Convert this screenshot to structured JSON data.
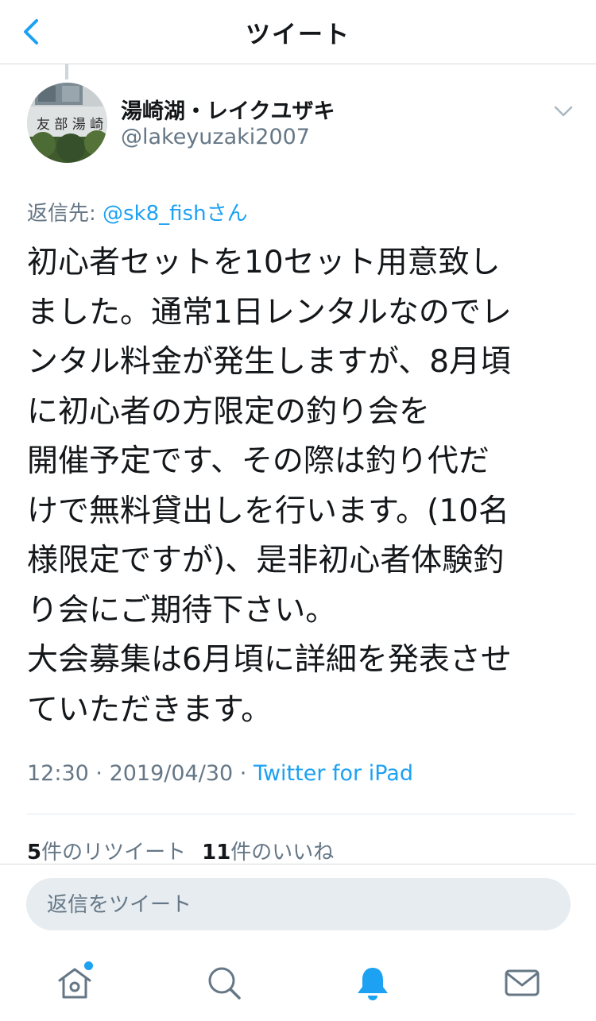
{
  "header": {
    "title": "ツイート"
  },
  "tweet": {
    "display_name": "湯崎湖・レイクユザキ",
    "handle": "@lakeyuzaki2007",
    "reply_to_prefix": "返信先: ",
    "reply_to_mention": "@sk8_fish",
    "reply_to_suffix": "さん",
    "body": "初心者セットを10セット用意致し\nました。通常1日レンタルなのでレ\nンタル料金が発生しますが、8月頃\nに初心者の方限定の釣り会を\n開催予定です、その際は釣り代だ\nけで無料貸出しを行います。(10名\n様限定ですが)、是非初心者体験釣\nり会にご期待下さい。\n大会募集は6月頃に詳細を発表させ\nていただきます。",
    "time": "12:30",
    "date": "2019/04/30",
    "separator": " · ",
    "source": "Twitter for iPad",
    "retweet_count": "5",
    "retweet_label": "件のリツイート",
    "like_count": "11",
    "like_label": "件のいいね",
    "avatar_sign_text": "友部湯崎湖"
  },
  "reply_box": {
    "placeholder": "返信をツイート"
  },
  "tabbar": {
    "items": [
      {
        "icon": "home-icon",
        "has_notification_dot": true
      },
      {
        "icon": "search-icon"
      },
      {
        "icon": "notifications-bell-icon",
        "active": true
      },
      {
        "icon": "messages-envelope-icon"
      }
    ]
  },
  "colors": {
    "accent": "#1da1f2",
    "secondary_text": "#657786",
    "primary_text": "#14171a"
  }
}
